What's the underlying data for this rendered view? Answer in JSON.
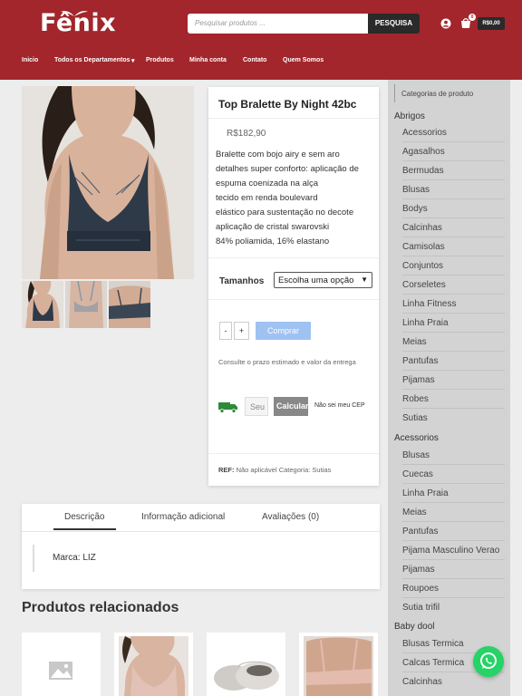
{
  "header": {
    "logo_text": "Fênix",
    "search_placeholder": "Pesquisar produtos ...",
    "search_button": "PESQUISA",
    "cart_count": "0",
    "cart_total": "R$0,00",
    "nav": [
      "Inicio",
      "Todos os Departamentos",
      "Produtos",
      "Minha conta",
      "Contato",
      "Quem Somos"
    ],
    "brand_color": "#a2262b"
  },
  "product": {
    "title": "Top Bralette By Night 42bc",
    "price": "R$182,90",
    "description": [
      "Bralette com bojo airy e sem aro",
      "detalhes super conforto: aplicação de",
      "espuma coenizada na alça",
      "tecido em renda boulevard",
      "elástico para sustentação no decote",
      "aplicação de cristal swarovski",
      "84% poliamida, 16% elastano"
    ],
    "size_label": "Tamanhos",
    "size_option": "Escolha uma opção",
    "qty_minus": "-",
    "qty_plus": "+",
    "buy_button": "Comprar",
    "delivery_note": "Consulte o prazo estimado e valor da entrega",
    "cep_placeholder": "Seu CEP",
    "calc_button": "Calcular",
    "no_cep_link": "Não sei meu CEP",
    "meta_ref_label": "REF:",
    "meta_ref_value": "Não aplicável",
    "meta_cat_label": "Categoria:",
    "meta_cat_value": "Sutias"
  },
  "tabs": {
    "items": [
      "Descrição",
      "Informação adicional",
      "Avaliações (0)"
    ],
    "content": "Marca: LIZ"
  },
  "related": {
    "title": "Produtos relacionados"
  },
  "sidebar": {
    "header": "Categorias de produto",
    "groups": [
      {
        "name": "Abrigos",
        "items": [
          "Acessorios",
          "Agasalhos",
          "Bermudas",
          "Blusas",
          "Bodys",
          "Calcinhas",
          "Camisolas",
          "Conjuntos",
          "Corseletes",
          "Linha Fitness",
          "Linha Praia",
          "Meias",
          "Pantufas",
          "Pijamas",
          "Robes",
          "Sutias"
        ]
      },
      {
        "name": "Acessorios",
        "items": [
          "Blusas",
          "Cuecas",
          "Linha Praia",
          "Meias",
          "Pantufas",
          "Pijama Masculino Verao",
          "Pijamas",
          "Roupoes",
          "Sutia trifil"
        ]
      },
      {
        "name": "Baby dool",
        "items": [
          "Blusas Termica",
          "Calcas Termica",
          "Calcinhas"
        ]
      }
    ]
  }
}
